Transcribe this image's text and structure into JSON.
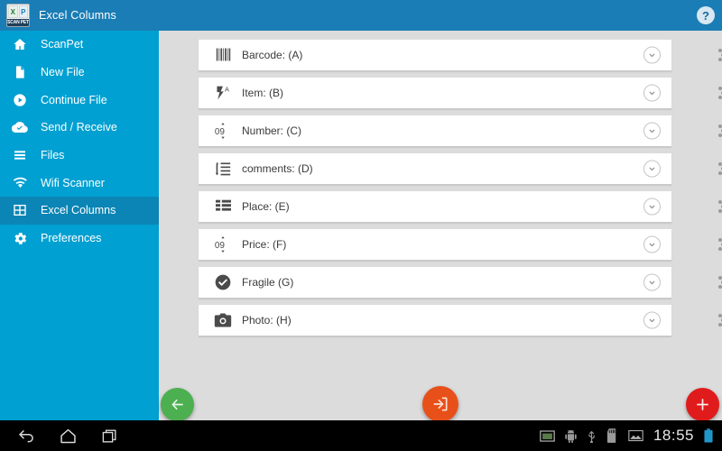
{
  "titlebar": {
    "app_title": "Excel Columns",
    "icon_name": "scan-pet-logo",
    "icon_caption": "SCAN PET",
    "icon_glyph_left": "X",
    "icon_glyph_right": "P",
    "help_label": "?",
    "bg_color": "#1a7db5"
  },
  "sidebar": {
    "bg_color": "#00a0d2",
    "selected_color": "#0b85b5",
    "items": [
      {
        "label": "ScanPet",
        "icon": "home-icon",
        "selected": false
      },
      {
        "label": "New File",
        "icon": "file-icon",
        "selected": false
      },
      {
        "label": "Continue File",
        "icon": "play-circle-icon",
        "selected": false
      },
      {
        "label": "Send / Receive",
        "icon": "cloud-check-icon",
        "selected": false
      },
      {
        "label": "Files",
        "icon": "list-icon",
        "selected": false
      },
      {
        "label": "Wifi Scanner",
        "icon": "wifi-icon",
        "selected": false
      },
      {
        "label": "Excel Columns",
        "icon": "grid-icon",
        "selected": true
      },
      {
        "label": "Preferences",
        "icon": "gear-icon",
        "selected": false
      }
    ]
  },
  "columns": {
    "rows": [
      {
        "label": "Barcode: (A)",
        "icon": "barcode-icon"
      },
      {
        "label": "Item: (B)",
        "icon": "flash-auto-icon"
      },
      {
        "label": "Number: (C)",
        "icon": "number-stepper-icon"
      },
      {
        "label": "comments: (D)",
        "icon": "line-height-icon"
      },
      {
        "label": "Place: (E)",
        "icon": "table-rows-icon"
      },
      {
        "label": "Price: (F)",
        "icon": "number-stepper-icon"
      },
      {
        "label": "Fragile (G)",
        "icon": "check-circle-icon"
      },
      {
        "label": "Photo: (H)",
        "icon": "camera-icon"
      }
    ],
    "expand_icon": "chevron-down-circle-icon",
    "drag_icon": "drag-handle-icon"
  },
  "actions": {
    "back_icon": "arrow-left-icon",
    "back_color": "#4caf50",
    "exit_icon": "exit-door-icon",
    "exit_color": "#e8501a",
    "add_icon": "plus-icon",
    "add_color": "#e01b1b"
  },
  "systembar": {
    "back_icon": "system-back-icon",
    "home_icon": "system-home-icon",
    "recents_icon": "system-recents-icon",
    "tray": [
      "screenshot-icon",
      "android-robot-icon",
      "usb-icon",
      "sd-card-icon",
      "image-icon"
    ],
    "clock": "18:55",
    "battery_icon": "battery-icon"
  }
}
